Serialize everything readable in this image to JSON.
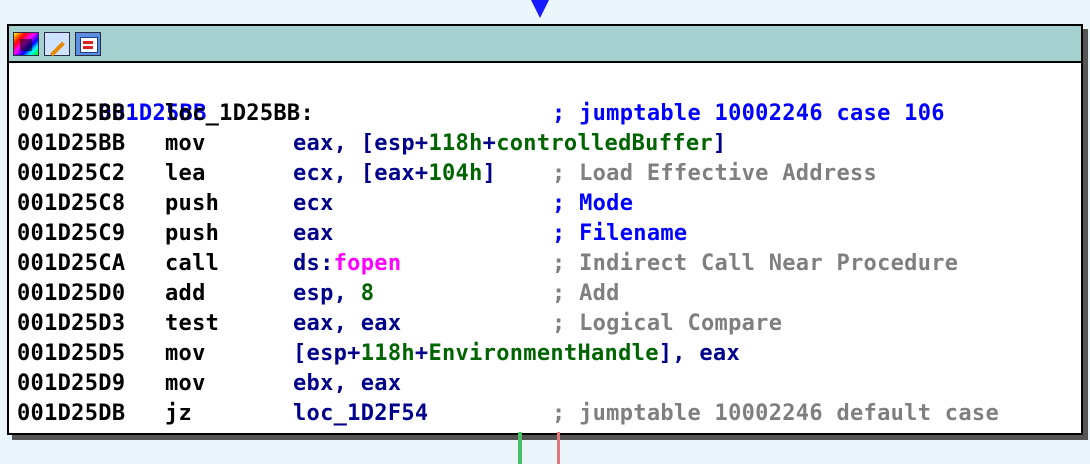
{
  "node": {
    "header_icons": [
      "color-palette-icon",
      "rename-pencil-icon",
      "graph-view-icon"
    ],
    "label_addr": "001D25BB",
    "lines": [
      {
        "addr": "001D25BB",
        "mn": "loc_1D25BB:",
        "ops": [],
        "comment": "; jumptable 10002246 case 106",
        "comment_style": "blue"
      },
      {
        "addr": "001D25BB",
        "mn": "mov",
        "ops": [
          {
            "t": "eax, [esp+",
            "c": "reg"
          },
          {
            "t": "118h",
            "c": "num"
          },
          {
            "t": "+",
            "c": "reg"
          },
          {
            "t": "controlledBuffer",
            "c": "num"
          },
          {
            "t": "]",
            "c": "reg"
          }
        ],
        "comment": "",
        "comment_style": "gray"
      },
      {
        "addr": "001D25C2",
        "mn": "lea",
        "ops": [
          {
            "t": "ecx, [eax+",
            "c": "reg"
          },
          {
            "t": "104h",
            "c": "num"
          },
          {
            "t": "]",
            "c": "reg"
          }
        ],
        "comment": "; Load Effective Address",
        "comment_style": "gray"
      },
      {
        "addr": "001D25C8",
        "mn": "push",
        "ops": [
          {
            "t": "ecx",
            "c": "reg"
          }
        ],
        "comment": "; Mode",
        "comment_style": "blue"
      },
      {
        "addr": "001D25C9",
        "mn": "push",
        "ops": [
          {
            "t": "eax",
            "c": "reg"
          }
        ],
        "comment": "; Filename",
        "comment_style": "blue"
      },
      {
        "addr": "001D25CA",
        "mn": "call",
        "ops": [
          {
            "t": "ds:",
            "c": "reg"
          },
          {
            "t": "fopen",
            "c": "ext"
          }
        ],
        "comment": "; Indirect Call Near Procedure",
        "comment_style": "gray"
      },
      {
        "addr": "001D25D0",
        "mn": "add",
        "ops": [
          {
            "t": "esp, ",
            "c": "reg"
          },
          {
            "t": "8",
            "c": "num"
          }
        ],
        "comment": "; Add",
        "comment_style": "gray"
      },
      {
        "addr": "001D25D3",
        "mn": "test",
        "ops": [
          {
            "t": "eax, eax",
            "c": "reg"
          }
        ],
        "comment": "; Logical Compare",
        "comment_style": "gray"
      },
      {
        "addr": "001D25D5",
        "mn": "mov",
        "ops": [
          {
            "t": "[esp+",
            "c": "reg"
          },
          {
            "t": "118h",
            "c": "num"
          },
          {
            "t": "+",
            "c": "reg"
          },
          {
            "t": "EnvironmentHandle",
            "c": "num"
          },
          {
            "t": "], eax",
            "c": "reg"
          }
        ],
        "comment": "",
        "comment_style": "gray"
      },
      {
        "addr": "001D25D9",
        "mn": "mov",
        "ops": [
          {
            "t": "ebx, eax",
            "c": "reg"
          }
        ],
        "comment": "",
        "comment_style": "gray"
      },
      {
        "addr": "001D25DB",
        "mn": "jz",
        "ops": [
          {
            "t": "loc_1D2F54",
            "c": "reg"
          }
        ],
        "comment": "; jumptable 10002246 default case",
        "comment_style": "gray"
      }
    ]
  },
  "colors": {
    "background": "#eaf6fb",
    "header": "#a5d0d0",
    "register": "#00008b",
    "number": "#006400",
    "import": "#ff00ff",
    "comment_blue": "#0000ff",
    "comment_gray": "#7f7f7f",
    "edge_true": "#4cbf6a",
    "edge_false": "#e07a7a"
  }
}
